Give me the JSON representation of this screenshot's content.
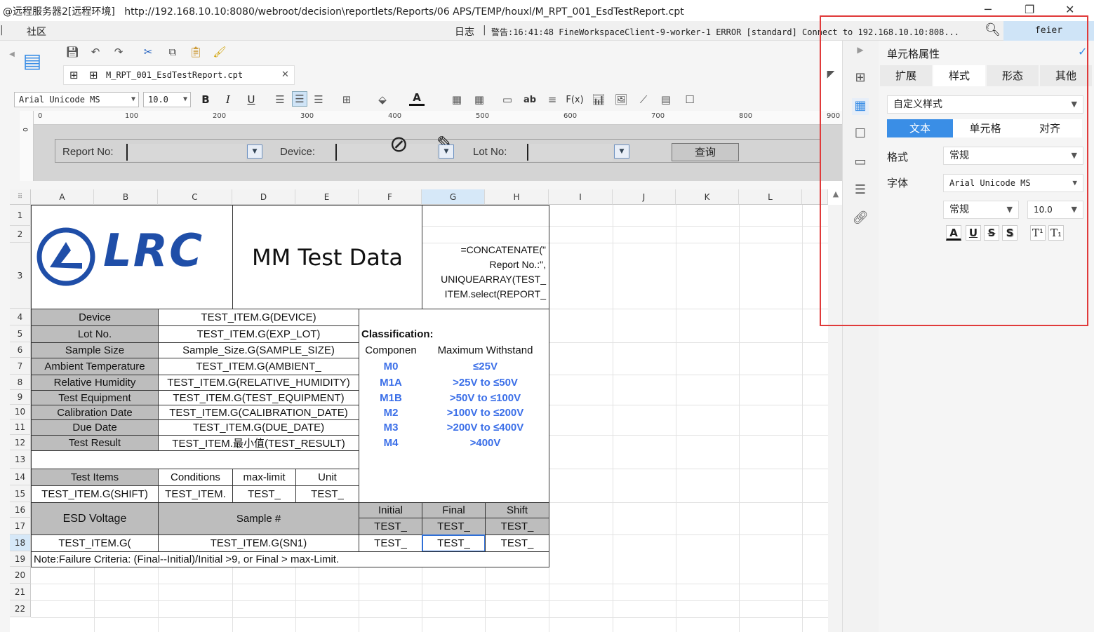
{
  "window": {
    "title_prefix": "@远程服务器2[远程环境]",
    "url": "http://192.168.10.10:8080/webroot/decision\\reportlets/Reports/06 APS/TEMP/houxl/M_RPT_001_EsdTestReport.cpt",
    "minimize": "─",
    "restore": "❐",
    "close": "✕"
  },
  "menubar": {
    "community": "社区",
    "log_label": "日志",
    "warning": "警告:16:41:48 FineWorkspaceClient-9-worker-1 ERROR [standard] Connect to 192.168.10.10:808...",
    "user": "feier"
  },
  "file_tab": {
    "name": "M_RPT_001_EsdTestReport.cpt",
    "close": "✕"
  },
  "format": {
    "font": "Arial Unicode MS",
    "size": "10.0"
  },
  "ruler": [
    "0",
    "100",
    "200",
    "300",
    "400",
    "500",
    "600",
    "700",
    "800",
    "900"
  ],
  "params": {
    "report_no": "Report No:",
    "device": "Device:",
    "lot_no": "Lot No:",
    "query": "查询"
  },
  "columns": [
    "A",
    "B",
    "C",
    "D",
    "E",
    "F",
    "G",
    "H",
    "I",
    "J",
    "K",
    "L"
  ],
  "rows": [
    "1",
    "2",
    "3",
    "4",
    "5",
    "6",
    "7",
    "8",
    "9",
    "10",
    "11",
    "12",
    "13",
    "14",
    "15",
    "16",
    "17",
    "18",
    "19",
    "20",
    "21",
    "22"
  ],
  "report": {
    "logo": "LRC",
    "title": "MM Test Data",
    "formula": "=CONCATENATE(\"Report No.:\", UNIQUEARRAY(TEST_ITEM.select(REPORT_NUM)), \" / \"...",
    "formula_lines": [
      "=CONCATENATE(\"",
      "Report No.:\",",
      "UNIQUEARRAY(TEST_",
      "ITEM.select(REPORT_"
    ],
    "info_labels": [
      "Device",
      "Lot No.",
      "Sample Size",
      "Ambient Temperature",
      "Relative Humidity",
      "Test Equipment",
      "Calibration Date",
      "Due Date",
      "Test Result"
    ],
    "info_values": [
      "TEST_ITEM.G(DEVICE)",
      "TEST_ITEM.G(EXP_LOT)",
      "Sample_Size.G(SAMPLE_SIZE)",
      "TEST_ITEM.G(AMBIENT_",
      "TEST_ITEM.G(RELATIVE_HUMIDITY)",
      "TEST_ITEM.G(TEST_EQUIPMENT)",
      "TEST_ITEM.G(CALIBRATION_DATE)",
      "TEST_ITEM.G(DUE_DATE)",
      "TEST_ITEM.最小值(TEST_RESULT)"
    ],
    "classification": "Classification:",
    "class_header": [
      "Componen",
      "Maximum Withstand"
    ],
    "class_rows": [
      [
        "M0",
        "≤25V"
      ],
      [
        "M1A",
        ">25V to ≤50V"
      ],
      [
        "M1B",
        ">50V to ≤100V"
      ],
      [
        "M2",
        ">100V to ≤200V"
      ],
      [
        "M3",
        ">200V to ≤400V"
      ],
      [
        "M4",
        ">400V"
      ]
    ],
    "test_header": [
      "Test Items",
      "Conditions",
      "max-limit",
      "Unit"
    ],
    "test_row": [
      "TEST_ITEM.G(SHIFT)",
      "TEST_ITEM.",
      "TEST_",
      "TEST_"
    ],
    "esd_voltage": "ESD Voltage",
    "sample_no": "Sample #",
    "phase_header": [
      "Initial",
      "Final",
      "Shift"
    ],
    "phase_row": [
      "TEST_",
      "TEST_",
      "TEST_"
    ],
    "data_row": [
      "TEST_ITEM.G(",
      "TEST_ITEM.G(SN1)",
      "TEST_",
      "TEST_",
      "TEST_"
    ],
    "note": "Note:Failure Criteria: (Final--Initial)/Initial >9, or Final > max-Limit."
  },
  "props": {
    "title": "单元格属性",
    "tabs": [
      "扩展",
      "样式",
      "形态",
      "其他"
    ],
    "style_type": "自定义样式",
    "segments": [
      "文本",
      "单元格",
      "对齐"
    ],
    "format_label": "格式",
    "format_value": "常规",
    "font_label": "字体",
    "font_value": "Arial Unicode MS",
    "font_style": "常规",
    "font_size": "10.0",
    "style_buttons": [
      "A",
      "U",
      "S",
      "S",
      "T¹",
      "T₁"
    ]
  },
  "colors": {
    "accent": "#3a8ee6",
    "highlight": "#e03a3a",
    "class_blue": "#3b6fe8"
  }
}
